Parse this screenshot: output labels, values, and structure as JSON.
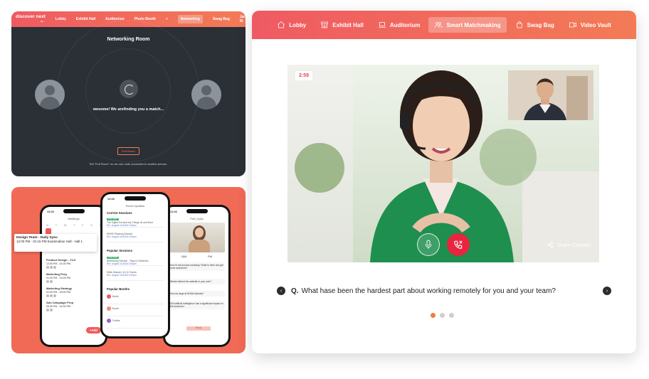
{
  "networking": {
    "logo_main": "discover next",
    "logo_sub": "by ...",
    "nav": [
      "Lobby",
      "Exhibit Hall",
      "Auditorium",
      "Photo Booth",
      "+",
      "Networking",
      "Swag Bag"
    ],
    "active_nav": "Networking",
    "user": "Jack M.",
    "title": "Networking Room",
    "status": "wesome! We arefinding you a match...",
    "exit_label": "Exit Room",
    "hint": "Sdt \"Exit Room\" so we can route youmatch to another person."
  },
  "mobile": {
    "time": "11:02",
    "phone1": {
      "header": "Meetings",
      "week": [
        "M",
        "T",
        "W",
        "T",
        "F",
        "S",
        "S"
      ],
      "popup_title": "Design Team - Daily Sync",
      "popup_sub": "12:00 PM - 01:15 PM   Examination Hall - Hall 1",
      "items": [
        {
          "title": "Product Design - YLG",
          "sub": "12:00 PM - 01:00 PM"
        },
        {
          "title": "Marketing Prep",
          "sub": "01:00 PM - 02:00 PM"
        },
        {
          "title": "Marketing Strategy",
          "sub": "02:00 PM - 03:00 PM"
        },
        {
          "title": "Ads Campaign Prep",
          "sub": "03:00 PM - 04:00 PM"
        }
      ],
      "add_label": "+Add"
    },
    "phone2": {
      "header": "Event Updates",
      "section1": "Current Sessions",
      "s1": [
        {
          "tag": "LIVE NOW",
          "title": "The Digital Era and Key Things: AI and More",
          "link": "Rm: August 16 AGM 4:00pm"
        },
        {
          "tag": "",
          "title": "WHEE Planning Session",
          "link": "Rm: August 16 AGM 4:00pm"
        }
      ],
      "section2": "Popular Sessions",
      "s2": [
        {
          "tag": "LIVE NOW",
          "title": "Networking Session - Tokyo & Networks",
          "link": "Rm: August 16 AGM 4:00pm"
        },
        {
          "tag": "",
          "title": "Skills Session | UX & Trends",
          "link": "Rm: August 16 AGM 4:00pm"
        }
      ],
      "section3": "Popular Booths",
      "booths": [
        "Booth",
        "Booth",
        "Further"
      ]
    },
    "phone3": {
      "header": "Poll | Q&A",
      "tabs": [
        "Q&A",
        "Poll"
      ],
      "questions": [
        "How to tell product meaning? What to think and get more awesome?",
        "What's behind the website to your own?",
        "How do large at NHAA industry?",
        "Did Artificial Intelligence has a significant impact on the business?"
      ],
      "reply_label": "Reply"
    }
  },
  "matchmaking": {
    "nav": [
      {
        "label": "Lobby",
        "icon": "home-icon"
      },
      {
        "label": "Exhibit Hall",
        "icon": "store-icon"
      },
      {
        "label": "Auditorium",
        "icon": "laptop-icon"
      },
      {
        "label": "Smart Matchmaking",
        "icon": "people-icon"
      },
      {
        "label": "Swag Bag",
        "icon": "bag-icon"
      },
      {
        "label": "Video Vault",
        "icon": "video-icon"
      }
    ],
    "active_nav": "Smart Matchmaking",
    "timer": "2:59",
    "share_label": "Share Contact",
    "question_prefix": "Q.",
    "question": "What hase been the hardest part about  working remotely  for you and your team?",
    "pagination_active": 0,
    "pagination_count": 3,
    "colors": {
      "accent_start": "#ef5a62",
      "accent_end": "#f37b56",
      "end_call": "#e8243f",
      "dot_active": "#f07b3f"
    }
  }
}
